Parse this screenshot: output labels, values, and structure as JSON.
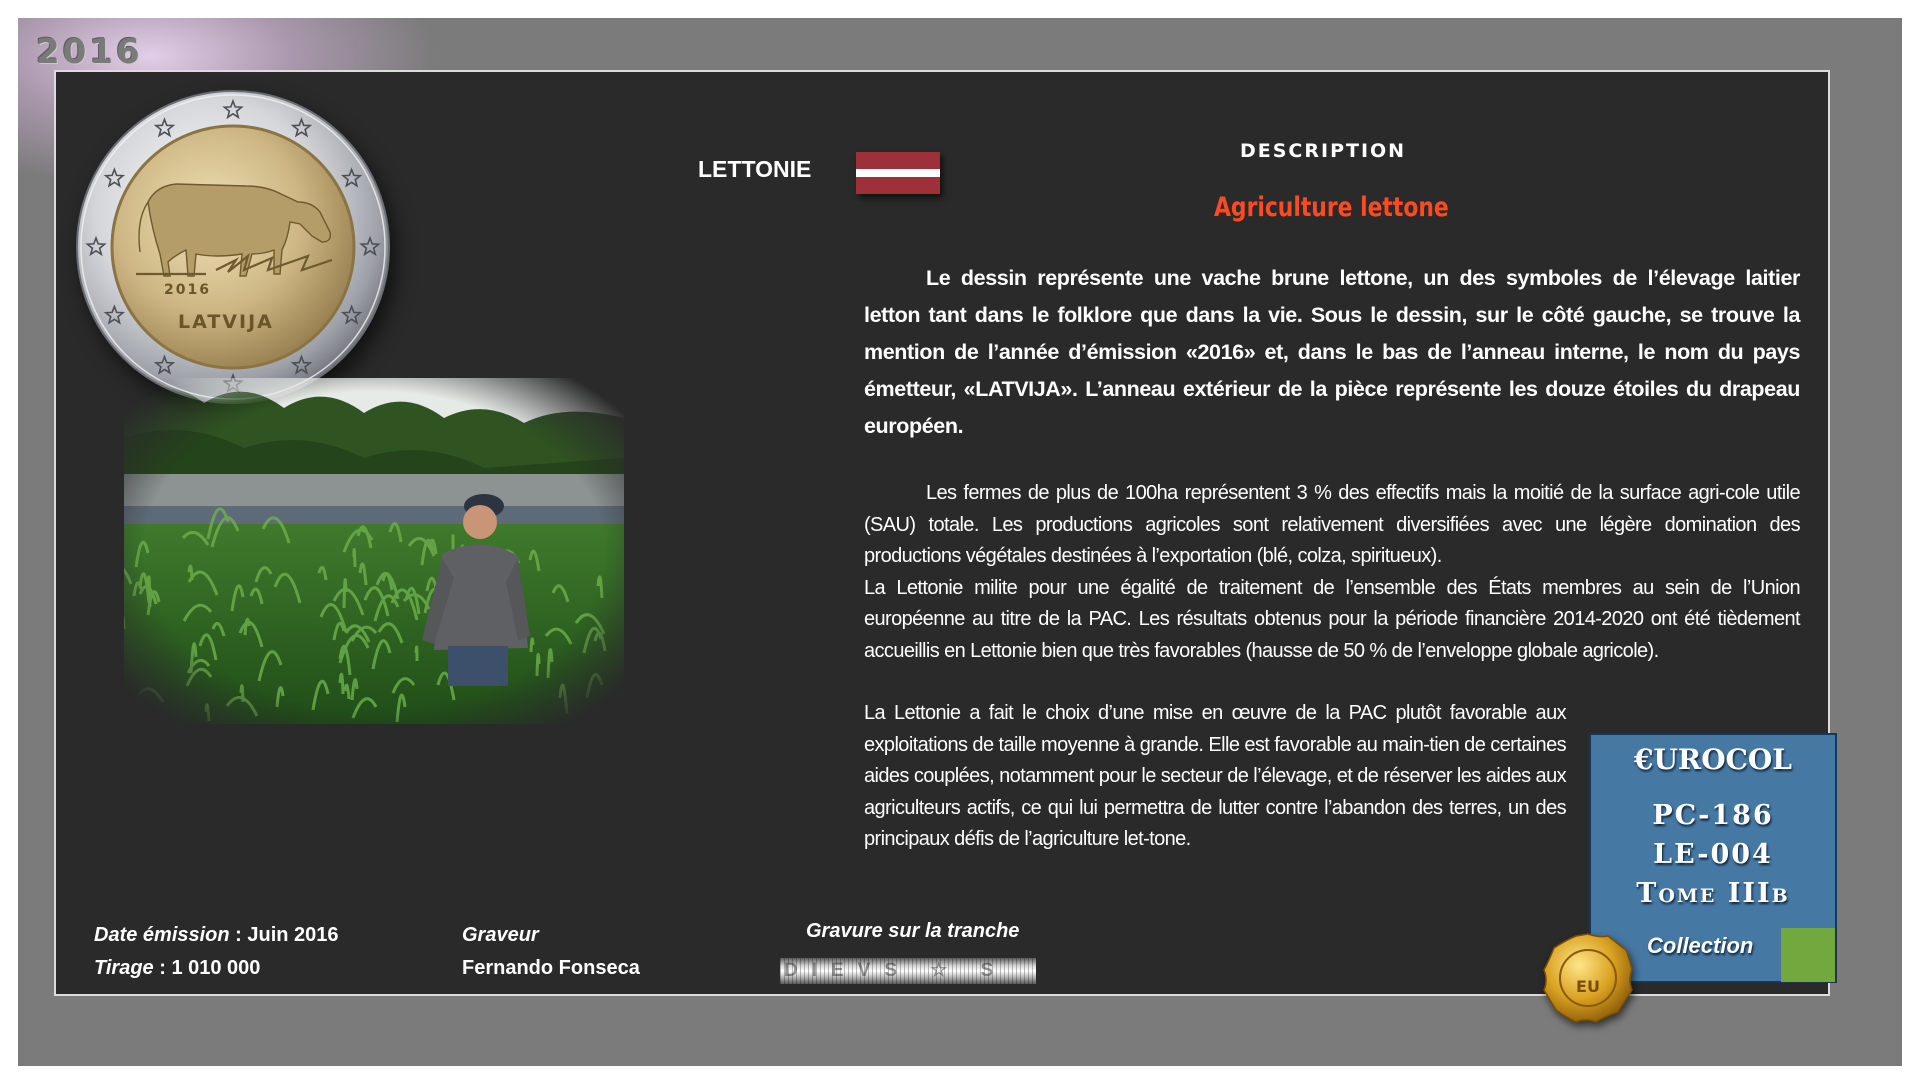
{
  "header": {
    "year_tab": "2016"
  },
  "coin": {
    "year": "2016",
    "country_text": "LATVIJA",
    "stars": 12
  },
  "country": {
    "name": "LETTONIE",
    "flag_colors": [
      "#9e3039",
      "#ffffff",
      "#9e3039"
    ]
  },
  "description": {
    "heading": "DESCRIPTION",
    "subject": "Agriculture lettone",
    "subject_color": "#ff4a22",
    "paragraph1": "Le dessin représente une vache brune lettone, un des symboles de l’élevage laitier letton tant dans le folklore que dans la vie. Sous le dessin, sur le côté gauche, se trouve la mention de l’année d’émission «2016» et, dans le bas de l’anneau interne, le nom du pays émetteur, «LATVIJA». L’anneau extérieur de la pièce représente les douze étoiles du drapeau européen.",
    "paragraph2": "Les fermes de plus de 100ha représentent 3 % des effectifs mais la moitié de la surface agri-cole utile (SAU) totale. Les productions agricoles sont relativement diversifiées avec une légère domination des productions végétales destinées à l’exportation (blé, colza, spiritueux).",
    "paragraph3": "La Lettonie milite pour une égalité de traitement de l’ensemble des États membres au sein de l’Union européenne au titre de la PAC. Les résultats obtenus pour la période financière 2014-2020 ont été tièdement accueillis en Lettonie bien que très favorables (hausse de 50 % de l’enveloppe globale agricole).",
    "paragraph4": "La Lettonie a fait le choix d’une mise en œuvre de la PAC plutôt favorable aux exploitations de taille moyenne à grande. Elle est favorable au main-tien de certaines aides couplées, notamment pour le secteur de l’élevage, et de réserver les aides aux agriculteurs actifs, ce qui lui permettra de lutter contre l’abandon des terres, un des principaux défis de l’agriculture let-tone."
  },
  "footer": {
    "date_label": "Date émission",
    "date_value": " : Juin 2016",
    "tirage_label": "Tirage",
    "tirage_value": " : 1 010 000",
    "graveur_label": "Graveur",
    "graveur_value": "Fernando Fonseca",
    "edge_label": "Gravure sur la tranche",
    "edge_text": "DIEVS ☆ S"
  },
  "eurocol": {
    "brand": "€UROCOL",
    "code1": "PC-186",
    "code2": "LE-004",
    "code3": "Tome IIIb",
    "collection": "Collection",
    "seal_text": "EU"
  }
}
